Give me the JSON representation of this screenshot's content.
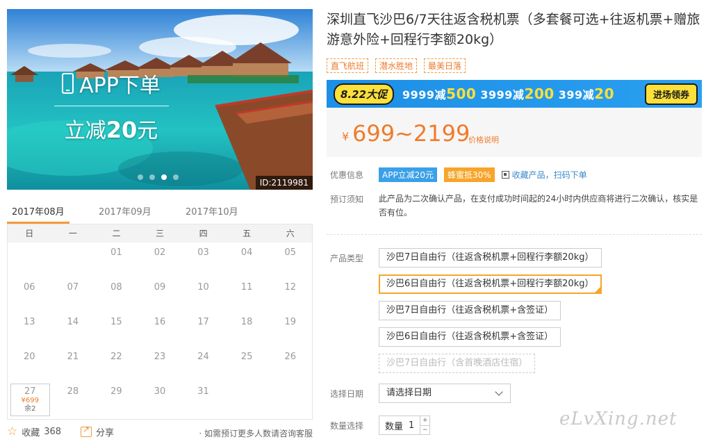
{
  "hero": {
    "promo_line1": "APP下单",
    "promo_line2_prefix": "立减",
    "promo_line2_amount": "20",
    "promo_line2_suffix": "元",
    "id_badge": "ID:2119981",
    "carousel_total": 4,
    "carousel_active": 3
  },
  "calendar": {
    "month_tabs": [
      "2017年08月",
      "2017年09月",
      "2017年10月"
    ],
    "active_month": "2017年08月",
    "weekdays": [
      "日",
      "一",
      "二",
      "三",
      "四",
      "五",
      "六"
    ],
    "days": [
      "",
      "",
      "01",
      "02",
      "03",
      "04",
      "05",
      "06",
      "07",
      "08",
      "09",
      "10",
      "11",
      "12",
      "13",
      "14",
      "15",
      "16",
      "17",
      "18",
      "19",
      "20",
      "21",
      "22",
      "23",
      "24",
      "25",
      "26",
      "27",
      "28",
      "29",
      "30",
      "31",
      "",
      ""
    ],
    "available_day": {
      "day": "27",
      "price": "¥699",
      "stock": "余2"
    }
  },
  "actions": {
    "favorite_label": "收藏",
    "favorite_count": "368",
    "share_label": "分享",
    "consult_text": "· 如需预订更多人数请咨询客服"
  },
  "product": {
    "title": "深圳直飞沙巴6/7天往返含税机票（多套餐可选+往返机票+赠旅游意外险+回程行李额20kg）",
    "tags": [
      "直飞航班",
      "潜水胜地",
      "最美日落"
    ]
  },
  "promo_banner": {
    "badge": "8.22大促",
    "offers": [
      {
        "threshold": "9999减",
        "amount": "500"
      },
      {
        "threshold": "3999减",
        "amount": "200"
      },
      {
        "threshold": "399减",
        "amount": "20"
      }
    ],
    "button": "进场领券",
    "colors": {
      "background": "#1c8fe6",
      "accent": "#fde03a"
    }
  },
  "price": {
    "currency": "¥",
    "range": "699~2199",
    "note": "价格说明",
    "color": "#f07b2a"
  },
  "discount": {
    "label": "优惠信息",
    "app_badge": "APP立减20元",
    "honey_badge": "蜂蜜抵30%",
    "qr_link": "收藏产品，扫码下单"
  },
  "notice": {
    "label": "预订须知",
    "text": "此产品为二次确认产品，在支付成功时间起的24小时内供应商将进行二次确认，核实是否有位。"
  },
  "product_type": {
    "label": "产品类型",
    "options": [
      "沙巴7日自由行（往返含税机票+回程行李额20kg）",
      "沙巴6日自由行（往返含税机票+回程行李额20kg）",
      "沙巴7日自由行（往返含税机票+含签证）",
      "沙巴6日自由行（往返含税机票+含签证）",
      "沙巴7日自由行（含首晚酒店住宿）"
    ],
    "selected_index": 1,
    "disabled_index": 4
  },
  "date": {
    "label": "选择日期",
    "placeholder": "请选择日期"
  },
  "quantity": {
    "label": "数量选择",
    "field_label": "数量",
    "value": "1",
    "plus": "+",
    "minus": "−"
  },
  "watermark": "eLvXing.net"
}
